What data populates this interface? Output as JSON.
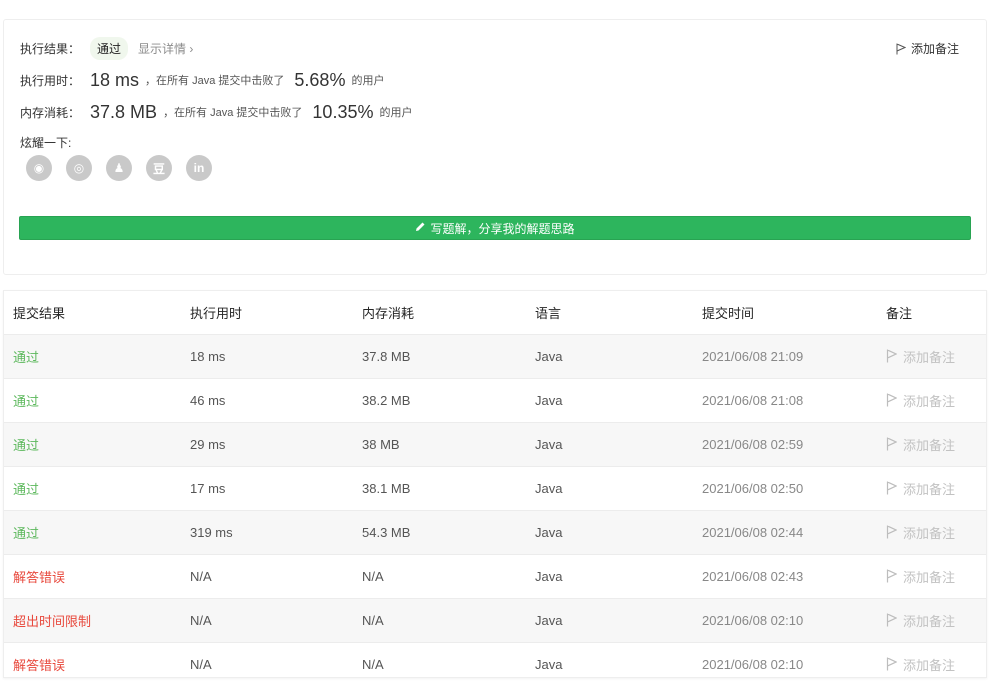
{
  "summary": {
    "result_label": "执行结果：",
    "result_value": "通过",
    "show_detail": "显示详情 ›",
    "add_note": "添加备注",
    "time_label": "执行用时：",
    "time_value": "18 ms",
    "time_mid": "，在所有 Java 提交中击败了",
    "time_percent": "5.68%",
    "time_suffix": "的用户",
    "mem_label": "内存消耗：",
    "mem_value": "37.8 MB",
    "mem_mid": "，在所有 Java 提交中击败了",
    "mem_percent": "10.35%",
    "mem_suffix": "的用户",
    "share_label": "炫耀一下:",
    "write_solution": "写题解，分享我的解题思路"
  },
  "socials": [
    {
      "name": "wechat-icon",
      "glyph": "◉"
    },
    {
      "name": "weibo-icon",
      "glyph": "◎"
    },
    {
      "name": "qq-icon",
      "glyph": "♟"
    },
    {
      "name": "douban-icon",
      "glyph": "豆"
    },
    {
      "name": "linkedin-icon",
      "glyph": "in"
    }
  ],
  "table": {
    "headers": [
      "提交结果",
      "执行用时",
      "内存消耗",
      "语言",
      "提交时间",
      "备注"
    ],
    "rows": [
      {
        "status": "通过",
        "kind": "ok",
        "time": "18 ms",
        "mem": "37.8 MB",
        "lang": "Java",
        "submitted": "2021/06/08 21:09",
        "note": "添加备注"
      },
      {
        "status": "通过",
        "kind": "ok",
        "time": "46 ms",
        "mem": "38.2 MB",
        "lang": "Java",
        "submitted": "2021/06/08 21:08",
        "note": "添加备注"
      },
      {
        "status": "通过",
        "kind": "ok",
        "time": "29 ms",
        "mem": "38 MB",
        "lang": "Java",
        "submitted": "2021/06/08 02:59",
        "note": "添加备注"
      },
      {
        "status": "通过",
        "kind": "ok",
        "time": "17 ms",
        "mem": "38.1 MB",
        "lang": "Java",
        "submitted": "2021/06/08 02:50",
        "note": "添加备注"
      },
      {
        "status": "通过",
        "kind": "ok",
        "time": "319 ms",
        "mem": "54.3 MB",
        "lang": "Java",
        "submitted": "2021/06/08 02:44",
        "note": "添加备注"
      },
      {
        "status": "解答错误",
        "kind": "err",
        "time": "N/A",
        "mem": "N/A",
        "lang": "Java",
        "submitted": "2021/06/08 02:43",
        "note": "添加备注"
      },
      {
        "status": "超出时间限制",
        "kind": "err",
        "time": "N/A",
        "mem": "N/A",
        "lang": "Java",
        "submitted": "2021/06/08 02:10",
        "note": "添加备注"
      },
      {
        "status": "解答错误",
        "kind": "err",
        "time": "N/A",
        "mem": "N/A",
        "lang": "Java",
        "submitted": "2021/06/08 02:10",
        "note": "添加备注"
      }
    ]
  },
  "colors": {
    "accent_green": "#2db55d",
    "pass_text": "#5cb85c",
    "error_text": "#e8493d"
  }
}
